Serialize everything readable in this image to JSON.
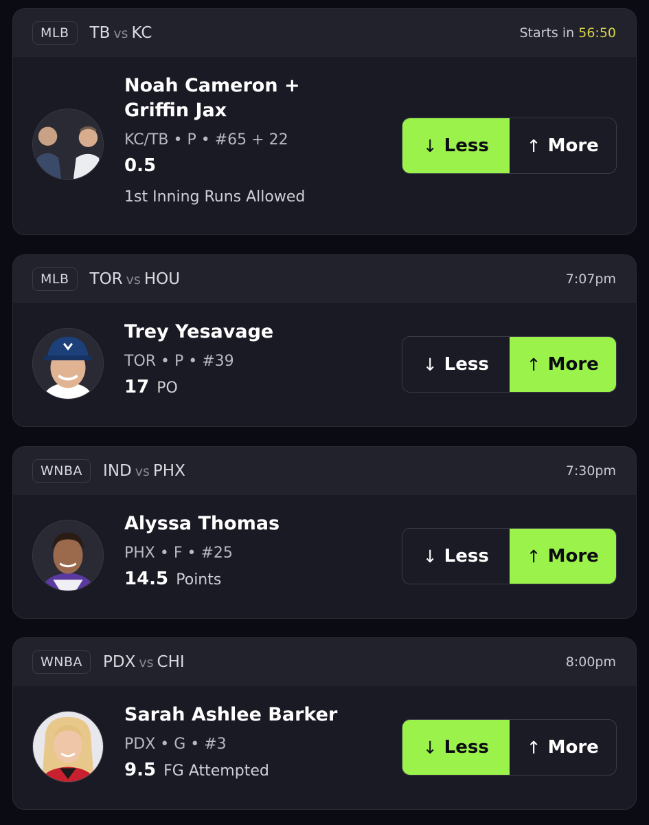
{
  "accent_color": "#9bf24a",
  "countdown_color": "#d7d34a",
  "cards": [
    {
      "league": "MLB",
      "team1": "TB",
      "vs": "vs",
      "team2": "KC",
      "time_prefix": "Starts in",
      "time_value": "56:50",
      "player_name_line1": "Noah Cameron +",
      "player_name_line2": "Griffin Jax",
      "meta": "KC/TB • P • #65 + 22",
      "line_value": "0.5",
      "stat": "1st Inning Runs Allowed",
      "less_label": "Less",
      "more_label": "More",
      "selected": "less"
    },
    {
      "league": "MLB",
      "team1": "TOR",
      "vs": "vs",
      "team2": "HOU",
      "time": "7:07pm",
      "player_name": "Trey Yesavage",
      "meta": "TOR • P • #39",
      "line_value": "17",
      "stat": "PO",
      "less_label": "Less",
      "more_label": "More",
      "selected": "more"
    },
    {
      "league": "WNBA",
      "team1": "IND",
      "vs": "vs",
      "team2": "PHX",
      "time": "7:30pm",
      "player_name": "Alyssa Thomas",
      "meta": "PHX • F • #25",
      "line_value": "14.5",
      "stat": "Points",
      "less_label": "Less",
      "more_label": "More",
      "selected": "more"
    },
    {
      "league": "WNBA",
      "team1": "PDX",
      "vs": "vs",
      "team2": "CHI",
      "time": "8:00pm",
      "player_name": "Sarah Ashlee Barker",
      "meta": "PDX • G • #3",
      "line_value": "9.5",
      "stat": "FG Attempted",
      "less_label": "Less",
      "more_label": "More",
      "selected": "less"
    }
  ]
}
